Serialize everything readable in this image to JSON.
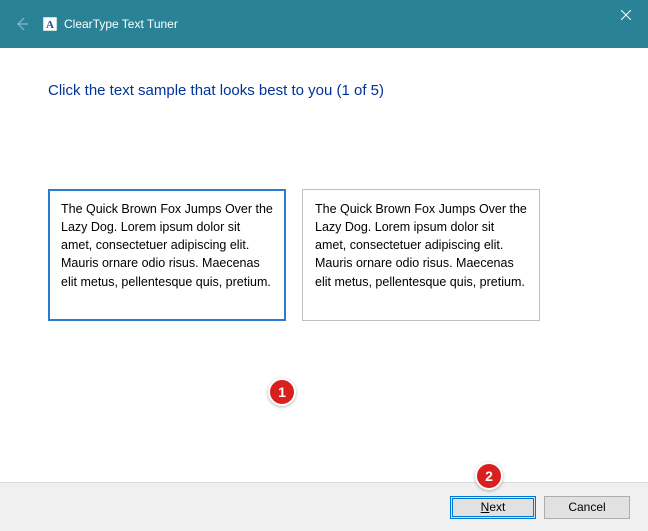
{
  "titlebar": {
    "title": "ClearType Text Tuner"
  },
  "instruction": "Click the text sample that looks best to you (1 of 5)",
  "samples": [
    {
      "text": "The Quick Brown Fox Jumps Over the Lazy Dog. Lorem ipsum dolor sit amet, consectetuer adipiscing elit. Mauris ornare odio risus. Maecenas elit metus, pellentesque quis, pretium.",
      "selected": true
    },
    {
      "text": "The Quick Brown Fox Jumps Over the Lazy Dog. Lorem ipsum dolor sit amet, consectetuer adipiscing elit. Mauris ornare odio risus. Maecenas elit metus, pellentesque quis, pretium.",
      "selected": false
    }
  ],
  "buttons": {
    "next": "Next",
    "cancel": "Cancel"
  },
  "annotations": {
    "badge1": "1",
    "badge2": "2"
  }
}
